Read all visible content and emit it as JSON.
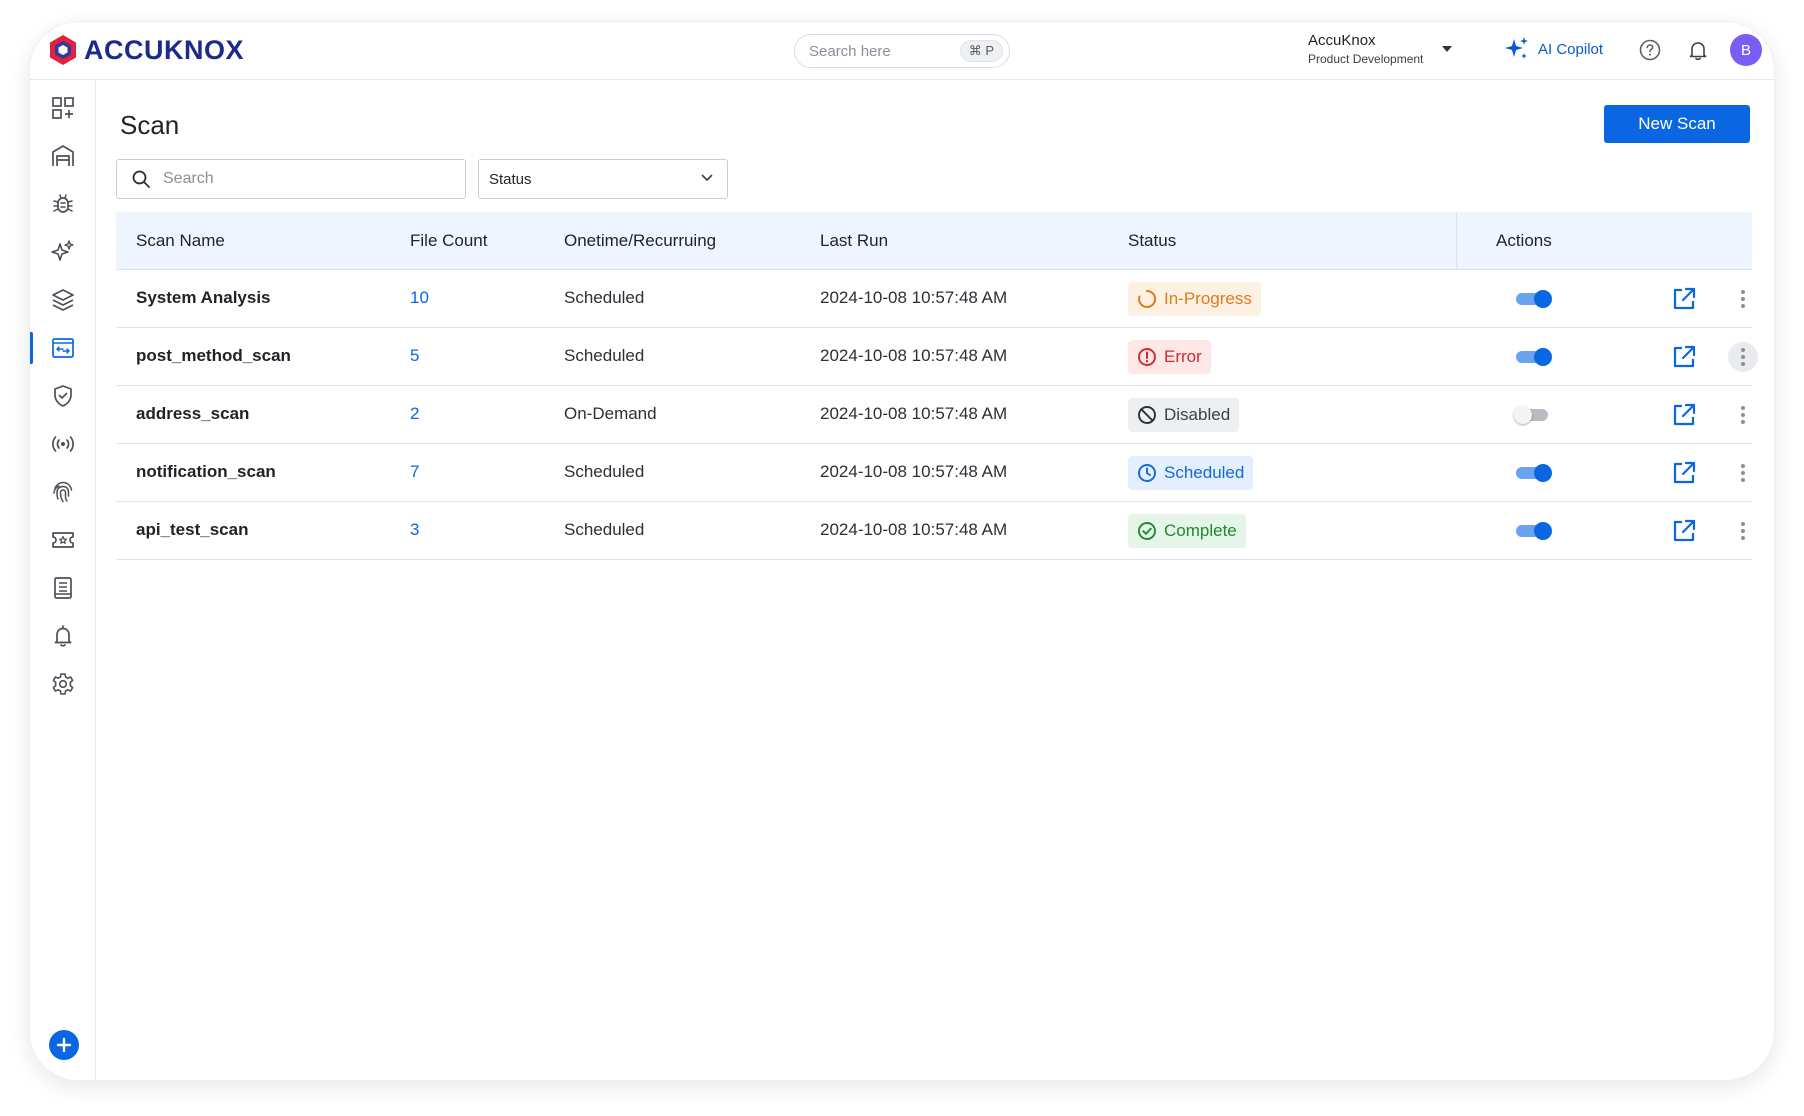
{
  "app": {
    "brand": "ACCUKNOX",
    "search_placeholder": "Search here",
    "search_shortcut": "⌘ P",
    "org_name": "AccuKnox",
    "org_sub": "Product Development",
    "copilot_label": "AI Copilot",
    "avatar_initial": "B"
  },
  "sidebar": {
    "items": [
      {
        "icon": "dashboard-icon"
      },
      {
        "icon": "warehouse-icon"
      },
      {
        "icon": "bug-icon"
      },
      {
        "icon": "sparkle-icon"
      },
      {
        "icon": "layers-icon"
      },
      {
        "icon": "scan-icon",
        "active": true
      },
      {
        "icon": "shield-icon"
      },
      {
        "icon": "broadcast-icon"
      },
      {
        "icon": "fingerprint-icon"
      },
      {
        "icon": "ticket-icon"
      },
      {
        "icon": "report-icon"
      },
      {
        "icon": "bell-icon"
      },
      {
        "icon": "settings-icon"
      }
    ]
  },
  "page": {
    "title": "Scan",
    "new_scan_label": "New Scan",
    "search_placeholder": "Search",
    "status_filter_label": "Status"
  },
  "table": {
    "headers": {
      "name": "Scan Name",
      "count": "File Count",
      "type": "Onetime/Recurruing",
      "last_run": "Last Run",
      "status": "Status",
      "actions": "Actions"
    },
    "rows": [
      {
        "name": "System Analysis",
        "count": "10",
        "type": "Scheduled",
        "last_run": "2024-10-08 10:57:48 AM",
        "status": "In-Progress",
        "enabled": true
      },
      {
        "name": "post_method_scan",
        "count": "5",
        "type": "Scheduled",
        "last_run": "2024-10-08 10:57:48 AM",
        "status": "Error",
        "enabled": true
      },
      {
        "name": "address_scan",
        "count": "2",
        "type": "On-Demand",
        "last_run": "2024-10-08 10:57:48 AM",
        "status": "Disabled",
        "enabled": false
      },
      {
        "name": "notification_scan",
        "count": "7",
        "type": "Scheduled",
        "last_run": "2024-10-08 10:57:48 AM",
        "status": "Scheduled",
        "enabled": true
      },
      {
        "name": "api_test_scan",
        "count": "3",
        "type": "Scheduled",
        "last_run": "2024-10-08 10:57:48 AM",
        "status": "Complete",
        "enabled": true
      }
    ]
  },
  "colors": {
    "primary": "#0b66e4",
    "in_progress_bg": "#fdf1e4",
    "in_progress_fg": "#e07b1a",
    "error_bg": "#fde7e7",
    "error_fg": "#d62a2a",
    "disabled_bg": "#eeeff1",
    "disabled_fg": "#3b4149",
    "scheduled_bg": "#e4effd",
    "scheduled_fg": "#1469d6",
    "complete_bg": "#e5f5e8",
    "complete_fg": "#23882f"
  }
}
